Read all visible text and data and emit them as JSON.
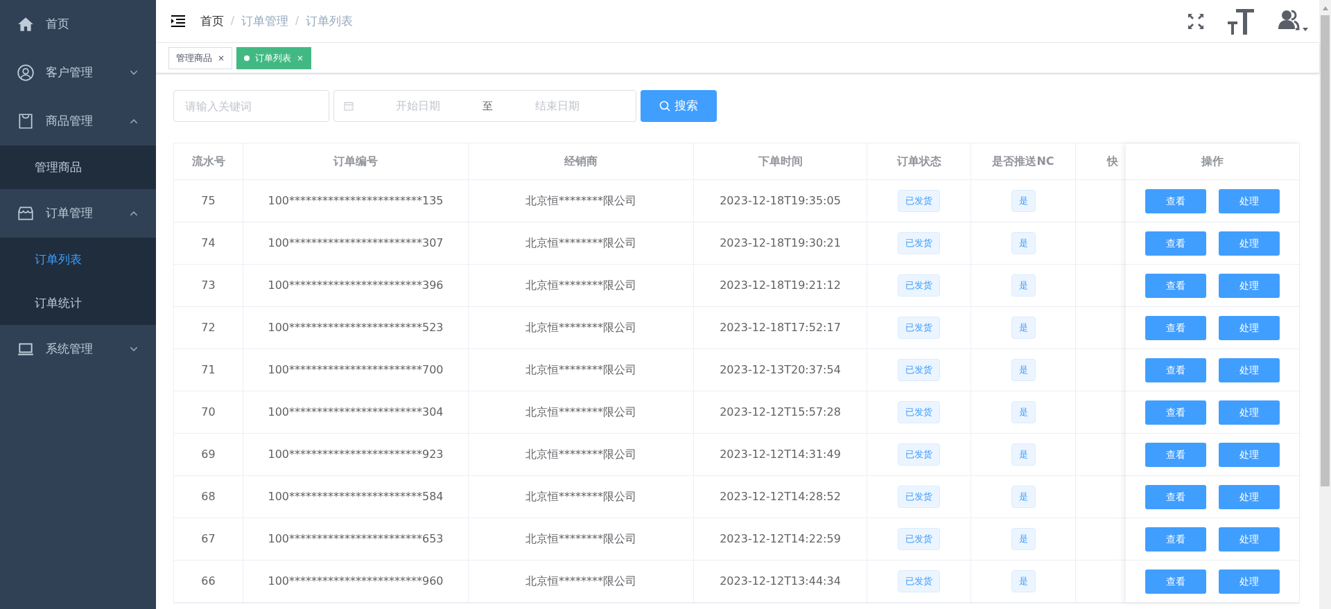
{
  "sidebar": {
    "items": [
      {
        "label": "首页"
      },
      {
        "label": "客户管理",
        "expanded": false
      },
      {
        "label": "商品管理",
        "expanded": true,
        "children": [
          {
            "label": "管理商品",
            "selected": false
          }
        ]
      },
      {
        "label": "订单管理",
        "expanded": true,
        "children": [
          {
            "label": "订单列表",
            "selected": true
          },
          {
            "label": "订单统计",
            "selected": false
          }
        ]
      },
      {
        "label": "系统管理",
        "expanded": false
      }
    ]
  },
  "breadcrumb": [
    {
      "label": "首页"
    },
    {
      "separator": "/",
      "label": "订单管理"
    },
    {
      "separator": "/",
      "label": "订单列表"
    }
  ],
  "tabs": [
    {
      "label": "管理商品",
      "selected": false,
      "close": "×"
    },
    {
      "label": "订单列表",
      "selected": true,
      "close": "×"
    }
  ],
  "search": {
    "keyword_placeholder": "请输入关键词",
    "start_placeholder": "开始日期",
    "separator": "至",
    "end_placeholder": "结束日期",
    "button": "搜索"
  },
  "table": {
    "columns": [
      "流水号",
      "订单编号",
      "经销商",
      "下单时间",
      "订单状态",
      "是否推送NC",
      "快",
      "操作"
    ],
    "rows": [
      {
        "id": "75",
        "order": "100************************135",
        "dealer": "北京恒********限公司",
        "time": "2023-12-18T19:35:05",
        "status": "已发货",
        "nc": "是",
        "actions": [
          "查看",
          "处理"
        ]
      },
      {
        "id": "74",
        "order": "100************************307",
        "dealer": "北京恒********限公司",
        "time": "2023-12-18T19:30:21",
        "status": "已发货",
        "nc": "是",
        "actions": [
          "查看",
          "处理"
        ]
      },
      {
        "id": "73",
        "order": "100************************396",
        "dealer": "北京恒********限公司",
        "time": "2023-12-18T19:21:12",
        "status": "已发货",
        "nc": "是",
        "actions": [
          "查看",
          "处理"
        ]
      },
      {
        "id": "72",
        "order": "100************************523",
        "dealer": "北京恒********限公司",
        "time": "2023-12-18T17:52:17",
        "status": "已发货",
        "nc": "是",
        "actions": [
          "查看",
          "处理"
        ]
      },
      {
        "id": "71",
        "order": "100************************700",
        "dealer": "北京恒********限公司",
        "time": "2023-12-13T20:37:54",
        "status": "已发货",
        "nc": "是",
        "actions": [
          "查看",
          "处理"
        ]
      },
      {
        "id": "70",
        "order": "100************************304",
        "dealer": "北京恒********限公司",
        "time": "2023-12-12T15:57:28",
        "status": "已发货",
        "nc": "是",
        "actions": [
          "查看",
          "处理"
        ]
      },
      {
        "id": "69",
        "order": "100************************923",
        "dealer": "北京恒********限公司",
        "time": "2023-12-12T14:31:49",
        "status": "已发货",
        "nc": "是",
        "actions": [
          "查看",
          "处理"
        ]
      },
      {
        "id": "68",
        "order": "100************************584",
        "dealer": "北京恒********限公司",
        "time": "2023-12-12T14:28:52",
        "status": "已发货",
        "nc": "是",
        "actions": [
          "查看",
          "处理"
        ]
      },
      {
        "id": "67",
        "order": "100************************653",
        "dealer": "北京恒********限公司",
        "time": "2023-12-12T14:22:59",
        "status": "已发货",
        "nc": "是",
        "actions": [
          "查看",
          "处理"
        ]
      },
      {
        "id": "66",
        "order": "100************************960",
        "dealer": "北京恒********限公司",
        "time": "2023-12-12T13:44:34",
        "status": "已发货",
        "nc": "是",
        "actions": [
          "查看",
          "处理"
        ]
      }
    ]
  }
}
